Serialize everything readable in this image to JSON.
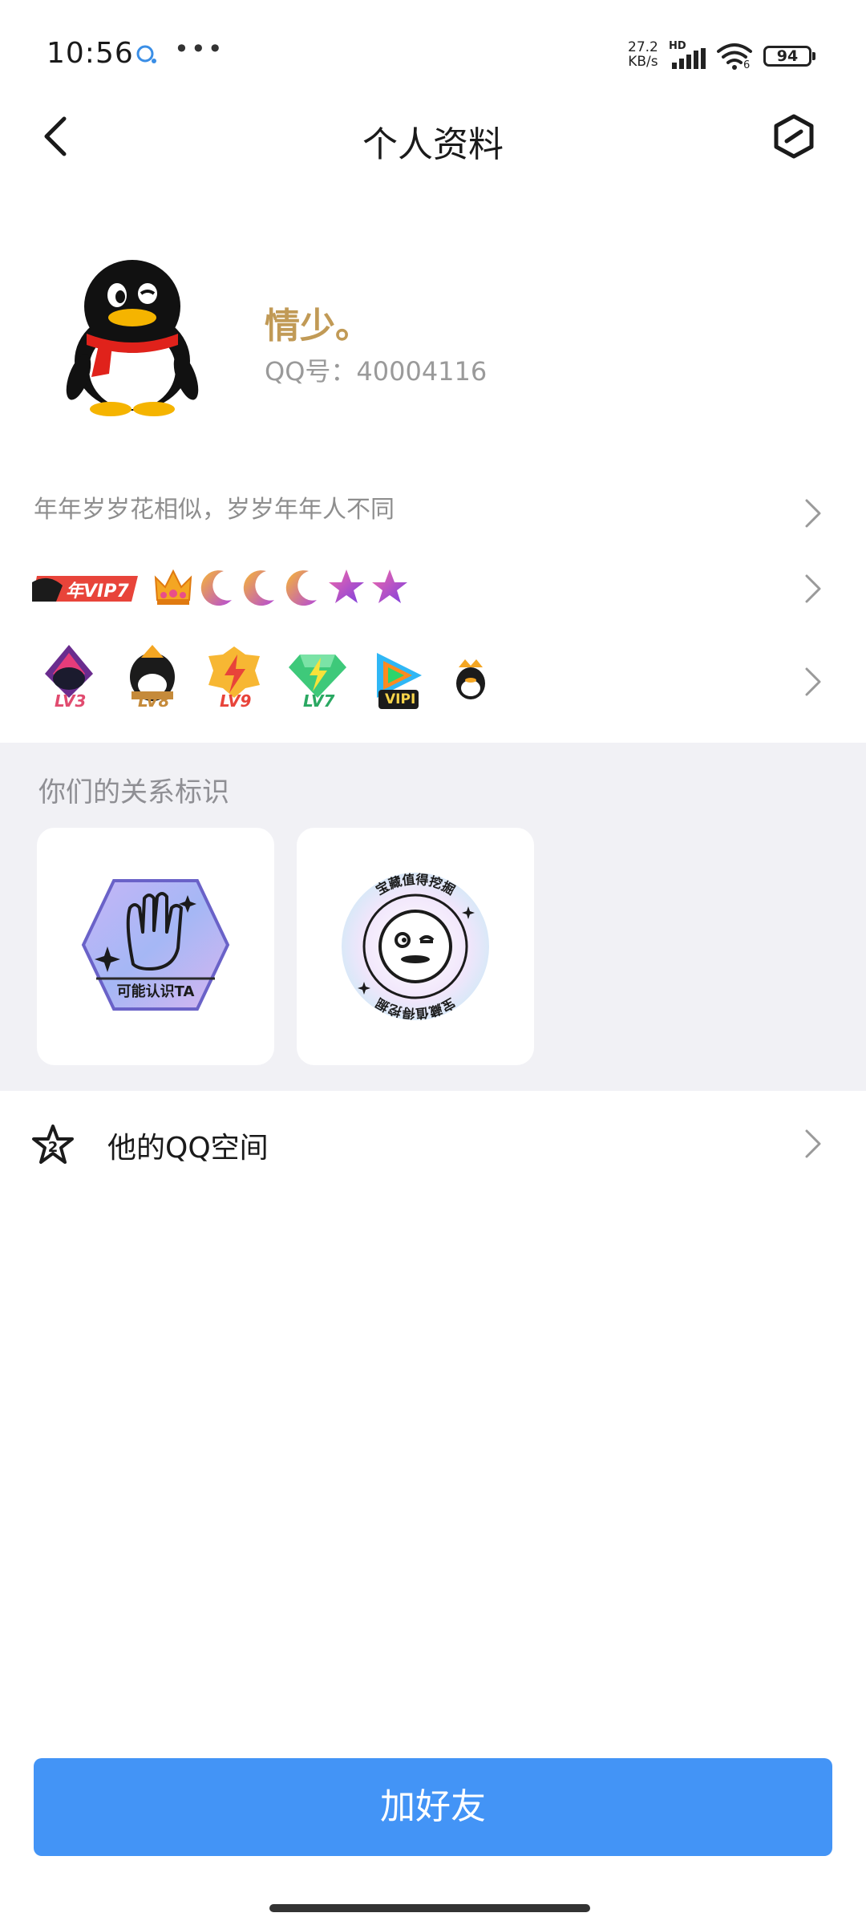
{
  "status_bar": {
    "time": "10:56",
    "net_speed_value": "27.2",
    "net_speed_unit": "KB/s",
    "hd": "HD",
    "wifi_sub": "6",
    "battery": "94",
    "icons": [
      "qq-notification-icon",
      "more-dots-icon",
      "signal-icon",
      "wifi-icon",
      "battery-icon"
    ]
  },
  "header": {
    "title": "个人资料",
    "back_icon": "chevron-left-icon",
    "settings_icon": "hexagon-settings-icon"
  },
  "profile": {
    "nickname": "情少。",
    "qq_number": "QQ号：40004116",
    "avatar": "qq-penguin-avatar"
  },
  "signature": "年年岁岁花相似，岁岁年年人不同",
  "vip": {
    "badge_text": "年VIP7",
    "badges": [
      "crown-icon",
      "moon-icon",
      "moon-icon",
      "moon-icon",
      "star-icon",
      "star-icon"
    ]
  },
  "levels": {
    "items": [
      {
        "label": "LV3",
        "icon": "level-3-icon"
      },
      {
        "label": "LV8",
        "icon": "level-8-icon"
      },
      {
        "label": "LV9",
        "icon": "level-9-icon"
      },
      {
        "label": "LV7",
        "icon": "level-7-icon"
      },
      {
        "label": "VIPI",
        "icon": "video-vip-icon"
      },
      {
        "label": "",
        "icon": "small-penguin-icon"
      }
    ]
  },
  "relation": {
    "title": "你们的关系标识",
    "cards": [
      {
        "label": "可能认识TA",
        "icon": "wave-hand-badge"
      },
      {
        "label": "宝藏值得挖掘",
        "icon": "treasure-face-badge"
      }
    ]
  },
  "qzone": {
    "label": "他的QQ空间",
    "icon": "qzone-star-icon"
  },
  "actions": {
    "add_friend": "加好友"
  }
}
